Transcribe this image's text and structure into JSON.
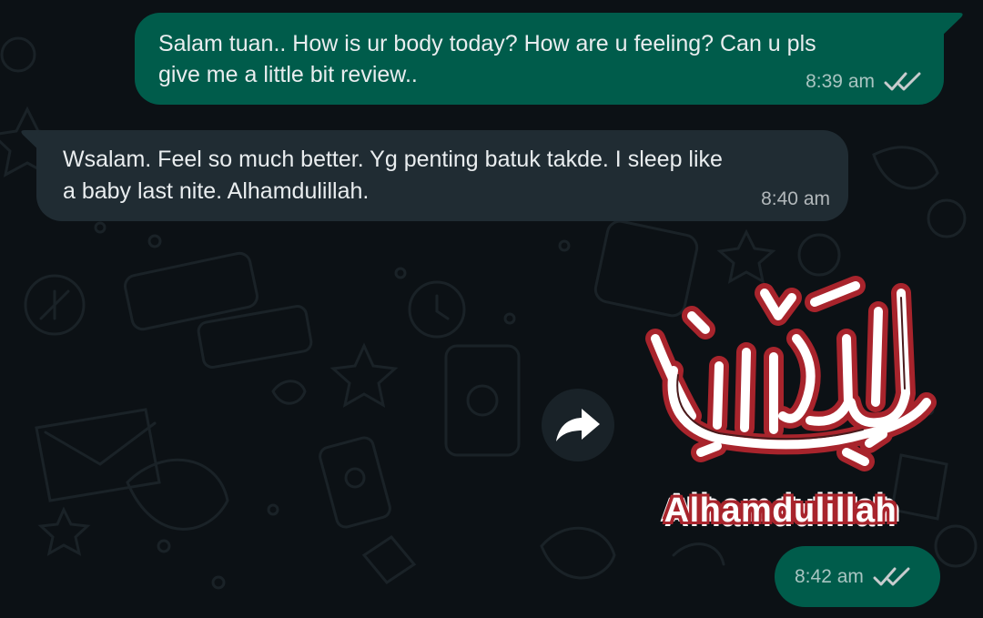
{
  "messages": [
    {
      "direction": "outgoing",
      "text_line1": "Salam tuan.. How is ur body today? How are u feeling? Can u pls",
      "text_line2": "give me a little bit review..",
      "time": "8:39 am",
      "status": "read"
    },
    {
      "direction": "incoming",
      "text_line1": "Wsalam. Feel so much better. Yg penting batuk takde. I sleep like",
      "text_line2": "a baby last nite. Alhamdulillah.",
      "time": "8:40 am"
    },
    {
      "direction": "outgoing",
      "type": "sticker",
      "sticker_caption": "Alhamdulillah",
      "time": "8:42 am",
      "status": "read"
    }
  ],
  "icons": {
    "forward": "forward-arrow-icon",
    "read_receipt": "double-check-icon"
  },
  "colors": {
    "background": "#0c1115",
    "outgoing_bubble": "#005c4b",
    "incoming_bubble": "#202c33",
    "text": "#e9edef",
    "meta_text": "#b3bbbf",
    "read_ticks": "#c8ccce",
    "sticker_outline": "#a8242c"
  }
}
